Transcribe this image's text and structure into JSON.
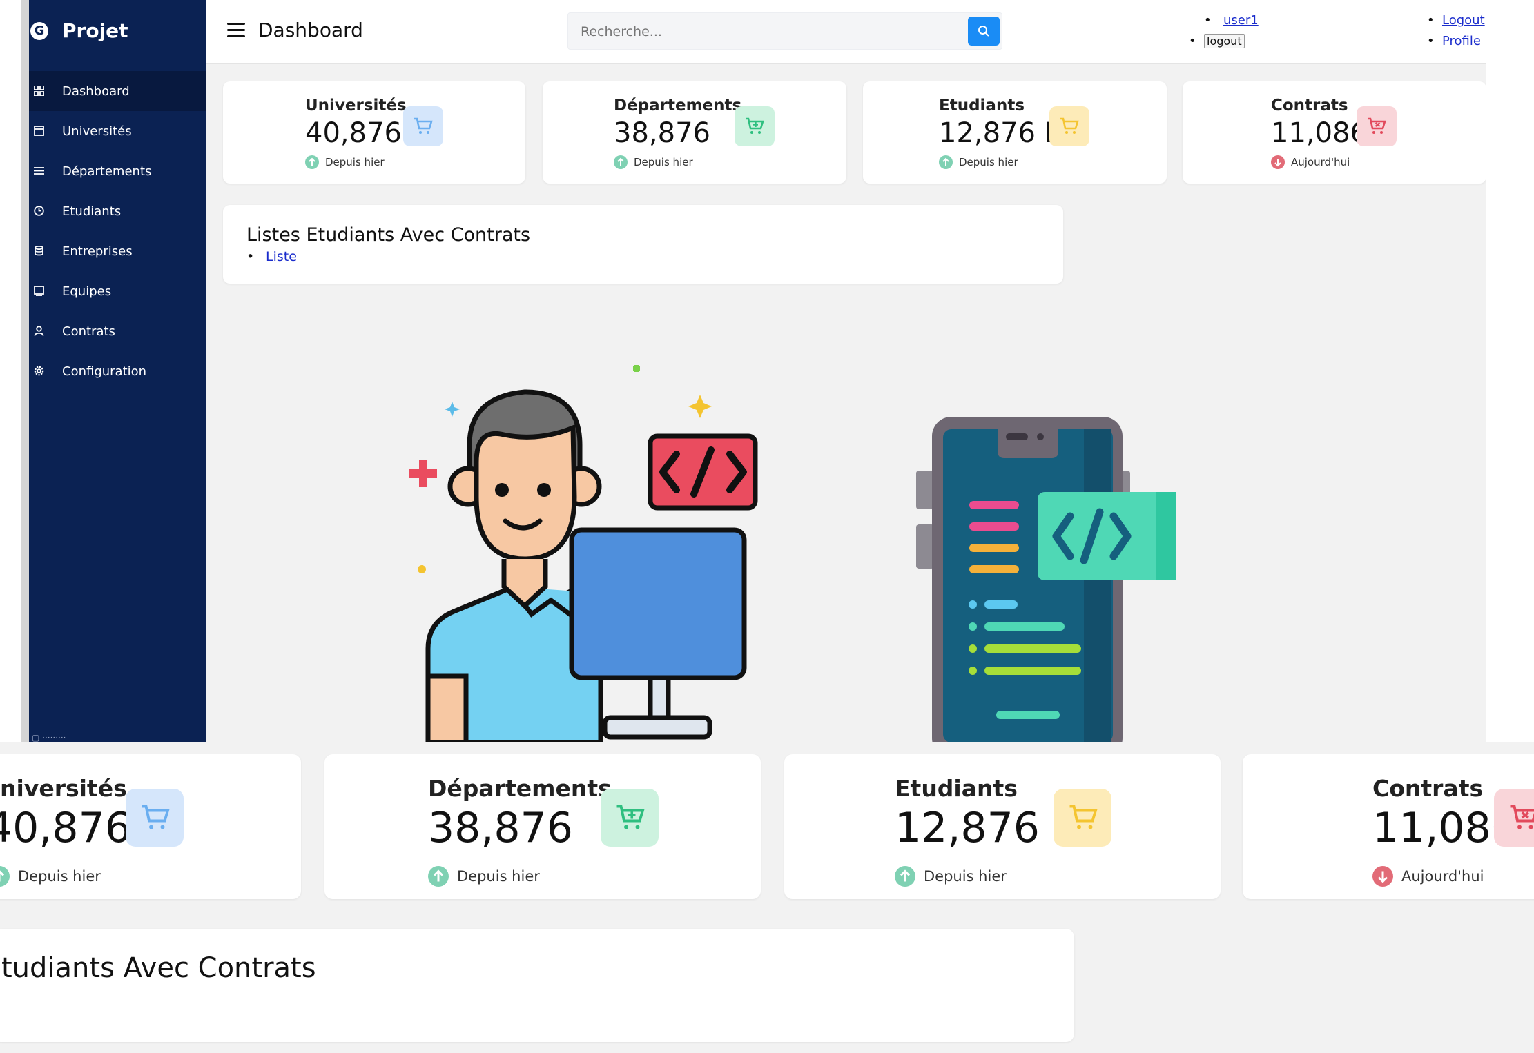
{
  "app": {
    "brand": "Projet",
    "page_title": "Dashboard"
  },
  "sidebar": {
    "items": [
      {
        "label": "Dashboard",
        "icon": "grid-icon",
        "active": true
      },
      {
        "label": "Universités",
        "icon": "building-icon"
      },
      {
        "label": "Départements",
        "icon": "list-icon"
      },
      {
        "label": "Etudiants",
        "icon": "clock-icon"
      },
      {
        "label": "Entreprises",
        "icon": "database-icon"
      },
      {
        "label": "Equipes",
        "icon": "square-icon"
      },
      {
        "label": "Contrats",
        "icon": "user-icon"
      },
      {
        "label": "Configuration",
        "icon": "gear-icon"
      }
    ]
  },
  "search": {
    "placeholder": "Recherche..."
  },
  "user_menu": {
    "username": "user1",
    "logout_button": "logout",
    "logout_link": "Logout",
    "profile_link": "Profile"
  },
  "cards": [
    {
      "title": "Universités",
      "value": "40,876",
      "trend": "Depuis hier",
      "trend_dir": "up",
      "badge_color": "#d5e6fb",
      "icon_color": "#6aaef0"
    },
    {
      "title": "Départements",
      "value": "38,876",
      "trend": "Depuis hier",
      "trend_dir": "up",
      "badge_color": "#cdf2df",
      "icon_color": "#2fbf80"
    },
    {
      "title": "Etudiants",
      "value": "12,876 F",
      "trend": "Depuis hier",
      "trend_dir": "up",
      "badge_color": "#fdebb8",
      "icon_color": "#f4c430"
    },
    {
      "title": "Contrats",
      "value": "11,086",
      "trend": "Aujourd'hui",
      "trend_dir": "down",
      "badge_color": "#f9d5d9",
      "icon_color": "#e24a5c"
    }
  ],
  "list_panel": {
    "title": "Listes Etudiants Avec Contrats",
    "link": "Liste"
  },
  "zoom": {
    "card_1_title": "niversités",
    "card_1_value": "40,876",
    "card_1_trend": "Depuis hier",
    "list_title": "tudiants Avec Contrats"
  }
}
